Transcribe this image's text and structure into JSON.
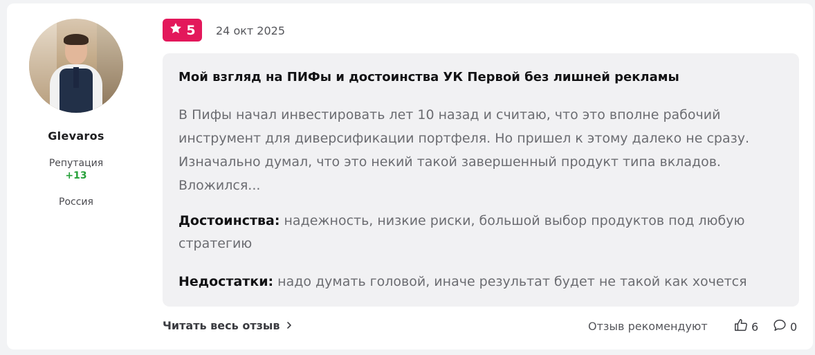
{
  "author": {
    "username": "Glevaros",
    "reputation_label": "Репутация",
    "reputation_value": "+13",
    "country": "Россия"
  },
  "review": {
    "rating": "5",
    "date": "24 окт 2025",
    "title": "Мой взгляд на ПИФы и достоинства УК Первой без лишней рекламы",
    "text": "В Пифы начал инвестировать лет 10 назад и считаю, что это вполне рабочий инструмент для диверсификации портфеля. Но пришел к этому далеко не сразу. Изначально думал, что это некий такой завершенный продукт типа вкладов. Вложился...",
    "pros_label": "Достоинства:",
    "pros_text": " надежность, низкие риски, большой выбор продуктов под любую стратегию",
    "cons_label": "Недостатки:",
    "cons_text": " надо думать головой, иначе результат будет не такой как хочется"
  },
  "footer": {
    "read_more": "Читать весь отзыв",
    "recommend_text": "Отзыв рекомендуют",
    "likes_count": "6",
    "comments_count": "0"
  },
  "colors": {
    "rating_badge": "#e3185b",
    "reputation": "#27a13a",
    "review_background": "#f1f1f3"
  },
  "icons": {
    "rating": "star-icon",
    "read_more": "chevron-right-icon",
    "likes": "thumbs-up-icon",
    "comments": "comment-icon"
  }
}
